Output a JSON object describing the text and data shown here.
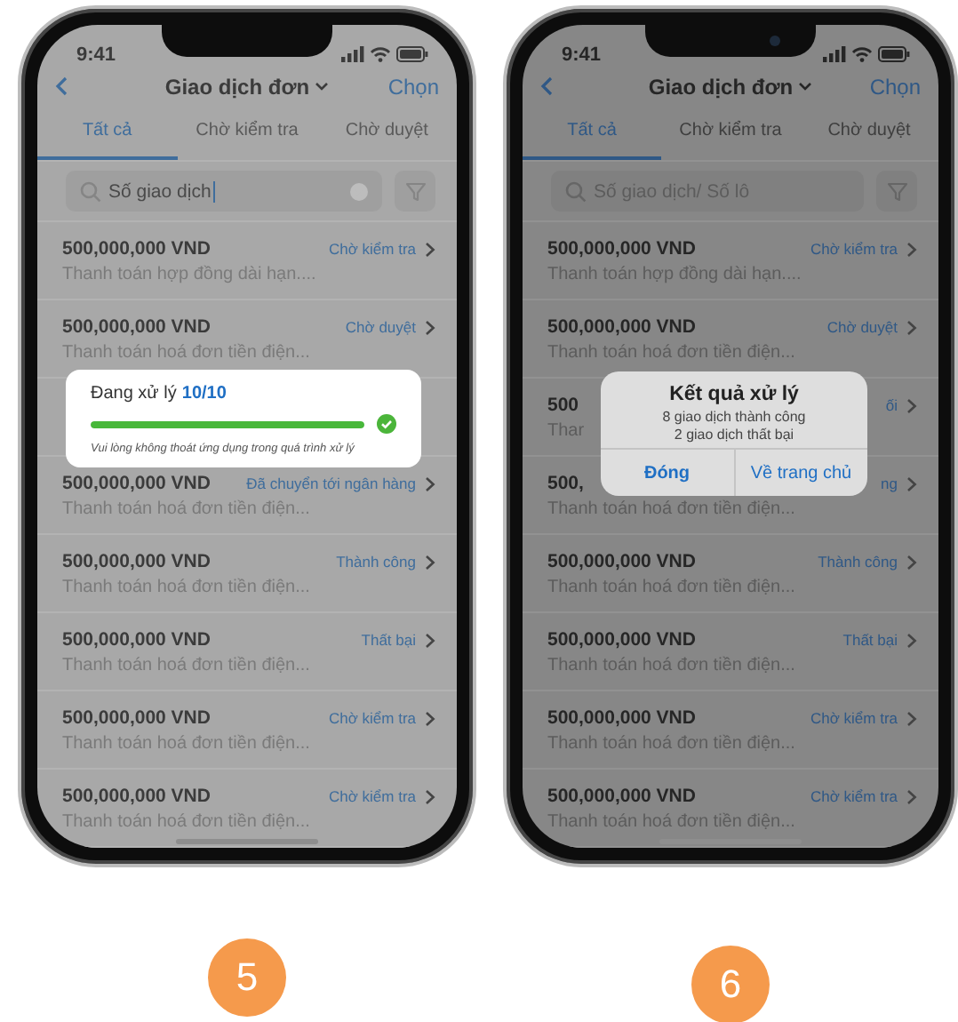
{
  "phones": [
    {
      "status_bar": {
        "time": "9:41"
      },
      "nav": {
        "title": "Giao dịch đơn",
        "action": "Chọn"
      },
      "tabs": [
        {
          "label": "Tất cả",
          "selected": true
        },
        {
          "label": "Chờ kiểm tra",
          "selected": false
        },
        {
          "label": "Chờ duyệt",
          "selected": false
        }
      ],
      "search": {
        "value": "Số giao dịch",
        "focused": true
      },
      "rows": [
        {
          "kind": "transaction",
          "amount": "500,000,000 VND",
          "description": "Thanh toán hợp đồng dài hạn....",
          "status": "Chờ kiểm tra"
        },
        {
          "kind": "transaction",
          "amount": "500,000,000 VND",
          "description": "Thanh toán hoá đơn tiền điện...",
          "status": "Chờ duyệt"
        },
        {
          "kind": "progress",
          "title": "Đang xử lý",
          "count": "10/10",
          "level": 1,
          "note": "Vui lòng không thoát ứng dụng trong quá trình xử lý"
        },
        {
          "kind": "transaction",
          "amount": "500,000,000 VND",
          "description": "Thanh toán hoá đơn tiền điện...",
          "status": "Đã chuyển tới ngân hàng"
        },
        {
          "kind": "transaction",
          "amount": "500,000,000 VND",
          "description": "Thanh toán hoá đơn tiền điện...",
          "status": "Thành công"
        },
        {
          "kind": "transaction",
          "amount": "500,000,000 VND",
          "description": "Thanh toán hoá đơn tiền điện...",
          "status": "Thất bại"
        },
        {
          "kind": "transaction",
          "amount": "500,000,000 VND",
          "description": "Thanh toán hoá đơn tiền điện...",
          "status": "Chờ kiểm tra"
        },
        {
          "kind": "transaction",
          "amount": "500,000,000 VND",
          "description": "Thanh toán hoá đơn tiền điện...",
          "status": "Chờ kiểm tra"
        }
      ],
      "badge": "5"
    },
    {
      "status_bar": {
        "time": "9:41"
      },
      "nav": {
        "title": "Giao dịch đơn",
        "action": "Chọn"
      },
      "tabs": [
        {
          "label": "Tất cả",
          "selected": true
        },
        {
          "label": "Chờ kiểm tra",
          "selected": false
        },
        {
          "label": "Chờ duyệt",
          "selected": false
        }
      ],
      "search": {
        "placeholder": "Số giao dịch/ Số lô"
      },
      "rows": [
        {
          "kind": "transaction",
          "amount": "500,000,000 VND",
          "description": "Thanh toán hợp đồng dài hạn....",
          "status": "Chờ kiểm tra"
        },
        {
          "kind": "transaction",
          "amount": "500,000,000 VND",
          "description": "Thanh toán hoá đơn tiền điện...",
          "status": "Chờ duyệt"
        },
        {
          "kind": "transaction",
          "amount": "500",
          "description": "Thar",
          "status": "ối"
        },
        {
          "kind": "alert",
          "title": "Kết quả xử lý",
          "lines": [
            "8 giao dịch thành công",
            "2 giao dịch thất bại"
          ],
          "buttons": [
            "Đóng",
            "Về trang chủ"
          ]
        },
        {
          "kind": "transaction",
          "amount": "500,",
          "description": "Thanh toán hoá đơn tiền điện...",
          "status": "ng"
        },
        {
          "kind": "transaction",
          "amount": "500,000,000 VND",
          "description": "Thanh toán hoá đơn tiền điện...",
          "status": "Thành công"
        },
        {
          "kind": "transaction",
          "amount": "500,000,000 VND",
          "description": "Thanh toán hoá đơn tiền điện...",
          "status": "Thất bại"
        },
        {
          "kind": "transaction",
          "amount": "500,000,000 VND",
          "description": "Thanh toán hoá đơn tiền điện...",
          "status": "Chờ kiểm tra"
        },
        {
          "kind": "transaction",
          "amount": "500,000,000 VND",
          "description": "Thanh toán hoá đơn tiền điện...",
          "status": "Chờ kiểm tra"
        }
      ],
      "badge": "6"
    }
  ]
}
